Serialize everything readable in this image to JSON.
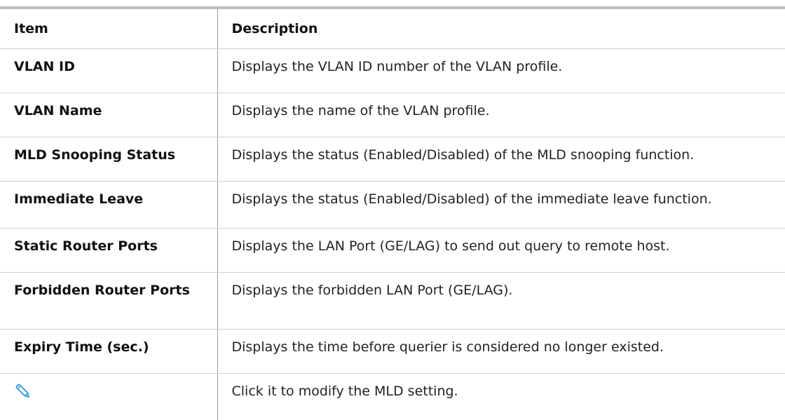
{
  "table": {
    "headers": {
      "item": "Item",
      "description": "Description"
    },
    "rows": [
      {
        "item": "VLAN ID",
        "description": "Displays the VLAN ID number of the VLAN profile."
      },
      {
        "item": "VLAN Name",
        "description": "Displays the name of the VLAN profile."
      },
      {
        "item": "MLD Snooping Status",
        "description": "Displays the status (Enabled/Disabled) of the MLD snooping function."
      },
      {
        "item": "Immediate Leave",
        "description": "Displays the status (Enabled/Disabled) of the immediate leave function."
      },
      {
        "item": "Static Router Ports",
        "description": "Displays the LAN Port (GE/LAG) to send out query to remote host."
      },
      {
        "item": "Forbidden Router Ports",
        "description": "Displays the forbidden LAN Port (GE/LAG)."
      },
      {
        "item": "Expiry Time (sec.)",
        "description": "Displays the time before querier is considered no longer existed."
      },
      {
        "item_icon": "pencil-edit-icon",
        "description": "Click it to modify the MLD setting."
      }
    ]
  },
  "colors": {
    "icon_accent": "#2f9bd6",
    "top_rule": "#bdbdbd"
  }
}
